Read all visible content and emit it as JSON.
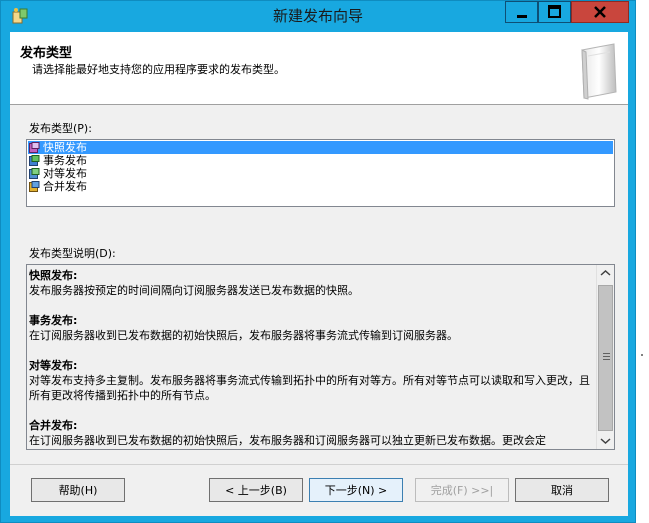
{
  "window": {
    "title": "新建发布向导",
    "accent": "#18a8e0",
    "close_color": "#c9463d"
  },
  "header": {
    "title": "发布类型",
    "subtitle": "请选择能最好地支持您的应用程序要求的发布类型。"
  },
  "type_list": {
    "label": "发布类型(P):",
    "items": [
      {
        "label": "快照发布",
        "icon": "snapshot-publication-icon",
        "selected": true
      },
      {
        "label": "事务发布",
        "icon": "transactional-publication-icon",
        "selected": false
      },
      {
        "label": "对等发布",
        "icon": "peer-to-peer-publication-icon",
        "selected": false
      },
      {
        "label": "合并发布",
        "icon": "merge-publication-icon",
        "selected": false
      }
    ]
  },
  "description": {
    "label": "发布类型说明(D):",
    "sections": [
      {
        "heading": "快照发布:",
        "text": "发布服务器按预定的时间间隔向订阅服务器发送已发布数据的快照。"
      },
      {
        "heading": "事务发布:",
        "text": "在订阅服务器收到已发布数据的初始快照后，发布服务器将事务流式传输到订阅服务器。"
      },
      {
        "heading": "对等发布:",
        "text": "对等发布支持多主复制。发布服务器将事务流式传输到拓扑中的所有对等方。所有对等节点可以读取和写入更改，且所有更改将传播到拓扑中的所有节点。"
      },
      {
        "heading": "合并发布:",
        "text": "在订阅服务器收到已发布数据的初始快照后，发布服务器和订阅服务器可以独立更新已发布数据。更改会定"
      }
    ]
  },
  "buttons": {
    "help": "帮助(H)",
    "back": "< 上一步(B)",
    "next": "下一步(N) >",
    "finish": "完成(F) >>|",
    "cancel": "取消"
  }
}
